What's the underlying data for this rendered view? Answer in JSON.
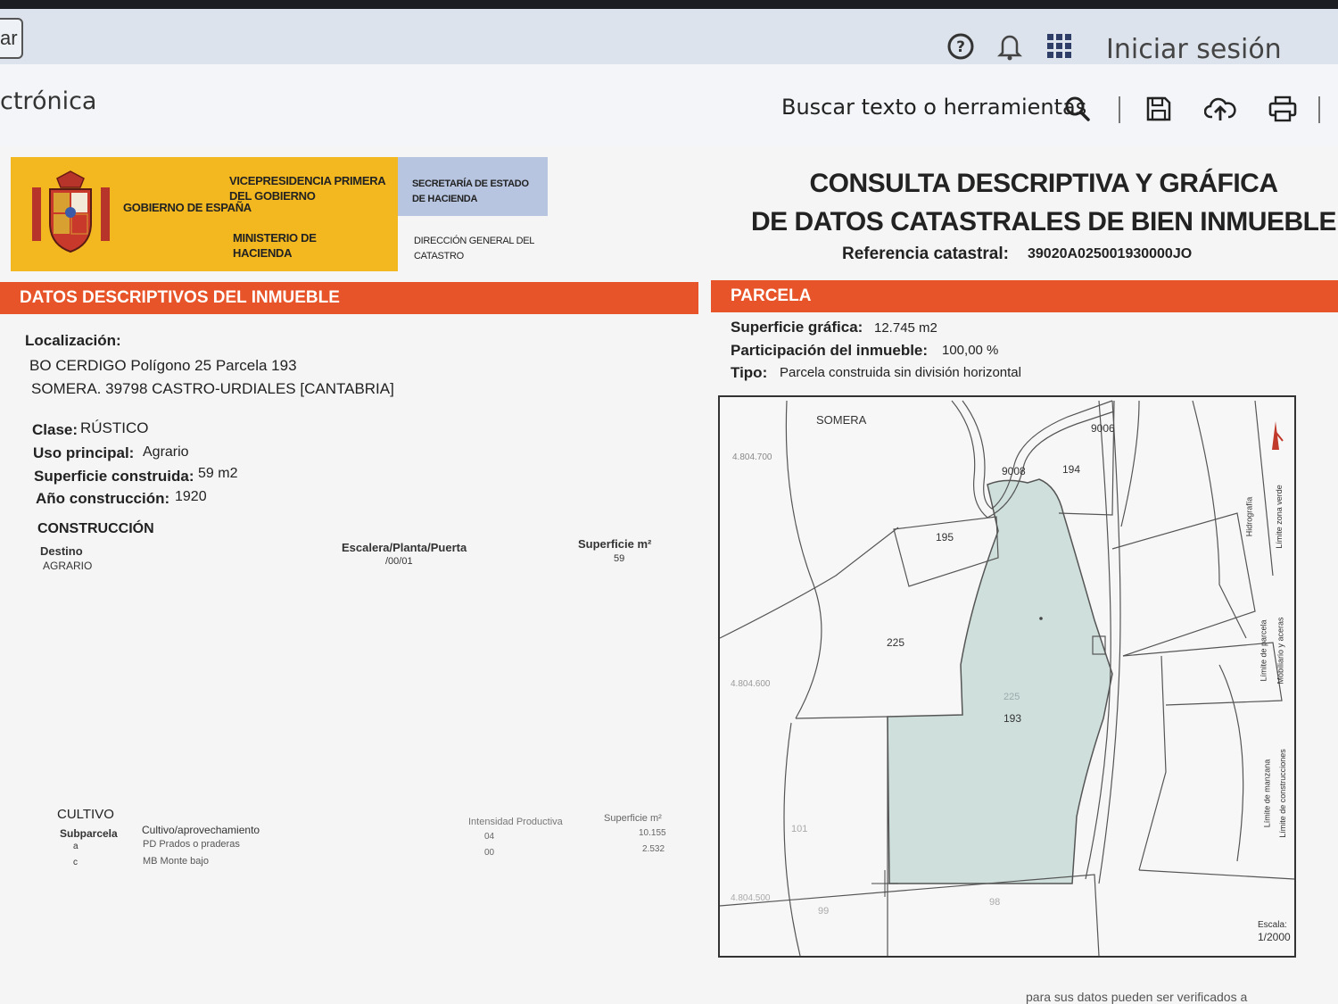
{
  "browser": {
    "tab_fragment": "ar",
    "signin_label": "Iniciar sesión"
  },
  "toolbar": {
    "app_title": "ctrónica",
    "search_label": "Buscar texto o herramientas"
  },
  "header": {
    "gov_name": "GOBIERNO DE ESPAÑA",
    "vicepresidencia": "VICEPRESIDENCIA PRIMERA DEL GOBIERNO",
    "ministerio": "MINISTERIO DE HACIENDA",
    "secretaria": "SECRETARÍA DE ESTADO DE HACIENDA",
    "direccion": "DIRECCIÓN GENERAL DEL CATASTRO",
    "title_line1": "CONSULTA DESCRIPTIVA Y GRÁFICA",
    "title_line2": "DE DATOS CATASTRALES DE BIEN INMUEBLE",
    "refcat_label": "Referencia catastral:",
    "refcat_value": "39020A025001930000JO"
  },
  "descriptivos": {
    "section_title": "DATOS DESCRIPTIVOS DEL INMUEBLE",
    "localizacion_label": "Localización:",
    "localizacion_line1": "BO CERDIGO  Polígono 25 Parcela 193",
    "localizacion_line2": "SOMERA. 39798 CASTRO-URDIALES [CANTABRIA]",
    "clase_label": "Clase:",
    "clase_value": "RÚSTICO",
    "uso_label": "Uso principal:",
    "uso_value": "Agrario",
    "superficie_label": "Superficie construida:",
    "superficie_value": "59 m2",
    "anio_label": "Año construcción:",
    "anio_value": "1920"
  },
  "construccion": {
    "title": "CONSTRUCCIÓN",
    "col_destino": "Destino",
    "col_escalera": "Escalera/Planta/Puerta",
    "col_superficie": "Superficie m²",
    "row_destino": "AGRARIO",
    "row_escalera": "/00/01",
    "row_superficie": "59"
  },
  "cultivo": {
    "title": "CULTIVO",
    "col_subparcela": "Subparcela",
    "col_cultivo": "Cultivo/aprovechamiento",
    "col_intensidad": "Intensidad Productiva",
    "col_superficie": "Superficie m²",
    "rows": [
      {
        "subparcela": "a",
        "cultivo": "PD Prados o praderas",
        "intensidad": "04",
        "superficie": "10.155"
      },
      {
        "subparcela": "c",
        "cultivo": "MB Monte bajo",
        "intensidad": "00",
        "superficie": "2.532"
      }
    ]
  },
  "parcela": {
    "section_title": "PARCELA",
    "superficie_label": "Superficie gráfica:",
    "superficie_value": "12.745 m2",
    "participacion_label": "Participación del inmueble:",
    "participacion_value": "100,00 %",
    "tipo_label": "Tipo:",
    "tipo_value": "Parcela construida sin división horizontal"
  },
  "map": {
    "place_label": "SOMERA",
    "coord_top": "4.804.700",
    "coord_mid": "4.804.600",
    "coord_bottom": "4.804.500",
    "parcel_labels": [
      "9006",
      "9008",
      "194",
      "195",
      "225",
      "193",
      "225",
      "101",
      "99",
      "98"
    ],
    "scale_label": "Escala:",
    "scale_value": "1/2000",
    "legend_items": [
      "Hidrografía",
      "Límite zona verde",
      "Límite de parcela",
      "Mobiliario y aceras",
      "Límite de manzana",
      "Límite de construcciones"
    ],
    "highlight_color": "#cfe0dc"
  },
  "footer_fragment": "para sus datos pueden ser verificados a"
}
